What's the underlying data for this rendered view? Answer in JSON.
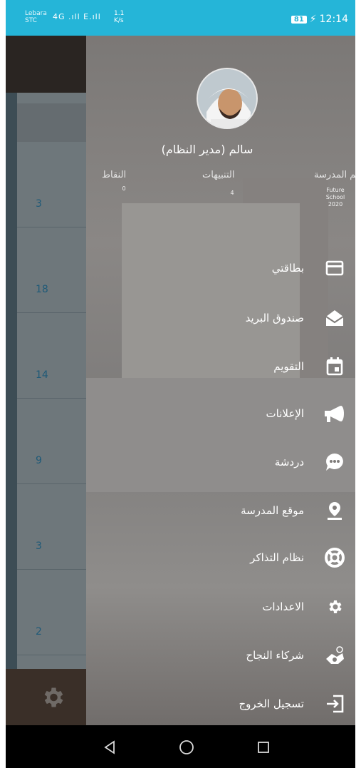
{
  "status_bar": {
    "carrier_top": "Lebara",
    "carrier_bottom": "STC",
    "signals": "4G .ıll  E.ıll",
    "speed_value": "1.1",
    "speed_unit": "K/s",
    "battery": "81",
    "time": "12:14"
  },
  "background": {
    "row_values": [
      "3",
      "18",
      "14",
      "9",
      "3",
      "2"
    ]
  },
  "drawer": {
    "user_name": "سالم (مدير النظام)",
    "stats": {
      "points_label": "النقاط",
      "points_value": "0",
      "alerts_label": "التنبيهات",
      "alerts_value": "4",
      "school_label": "اسم المدرسة",
      "school_value_line1": "Future",
      "school_value_line2": "School",
      "school_value_line3": "2020"
    },
    "menu": [
      {
        "label": "بطاقتي",
        "icon": "card-icon"
      },
      {
        "label": "صندوق البريد",
        "icon": "mailbox-icon"
      },
      {
        "label": "التقويم",
        "icon": "calendar-icon"
      },
      {
        "label": "الإعلانات",
        "icon": "megaphone-icon"
      },
      {
        "label": "دردشة",
        "icon": "chat-icon"
      },
      {
        "label": "موقع المدرسة",
        "icon": "location-pin-icon"
      },
      {
        "label": "نظام التذاكر",
        "icon": "lifebuoy-icon"
      },
      {
        "label": "الاعدادات",
        "icon": "gear-icon"
      },
      {
        "label": "شركاء النجاح",
        "icon": "partners-icon"
      },
      {
        "label": "تسجيل الخروج",
        "icon": "logout-icon"
      }
    ]
  },
  "colors": {
    "status_bar": "#25b5d8",
    "nav_bar": "#000000"
  }
}
